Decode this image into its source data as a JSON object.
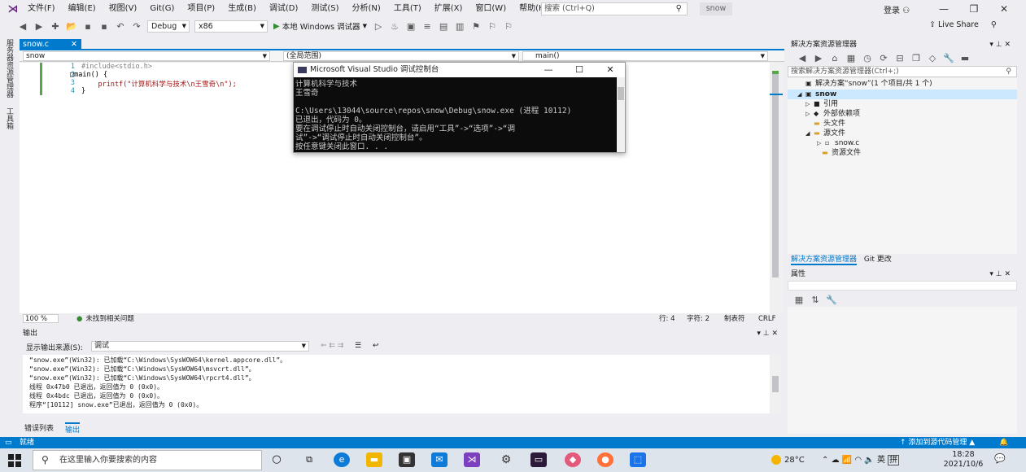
{
  "menubar": {
    "logo": "⋊",
    "items": [
      "文件(F)",
      "编辑(E)",
      "视图(V)",
      "Git(G)",
      "项目(P)",
      "生成(B)",
      "调试(D)",
      "测试(S)",
      "分析(N)",
      "工具(T)",
      "扩展(X)",
      "窗口(W)",
      "帮助(H)"
    ],
    "search_placeholder": "搜索 (Ctrl+Q)",
    "solution_name": "snow",
    "signin": "登录",
    "minimize": "—",
    "restore": "❐",
    "close": "✕"
  },
  "toolbar": {
    "config": "Debug",
    "platform": "x86",
    "run_label": "本地 Windows 调试器",
    "live_share": "Live Share"
  },
  "left_strip": {
    "tab1": "服务器资源管理器",
    "tab2": "工具箱"
  },
  "editor": {
    "tab_name": "snow.c",
    "tab_close": "✕",
    "nav_project": "snow",
    "nav_scope": "(全局范围)",
    "nav_member": "main()",
    "lines": [
      {
        "num": "1",
        "text": "#include<stdio.h>"
      },
      {
        "num": "2",
        "text": "□main() {"
      },
      {
        "num": "3",
        "text": "    printf(\"计算机科学与技术\\n王雪奇\\n\");"
      },
      {
        "num": "4",
        "text": "}"
      }
    ],
    "zoom": "100 %",
    "issues": "未找到相关问题",
    "row": "行: 4",
    "col": "字符: 2",
    "tabs_mode": "制表符",
    "eol": "CRLF"
  },
  "console": {
    "title": "Microsoft Visual Studio 调试控制台",
    "lines": [
      "计算机科学与技术",
      "王雪奇",
      "",
      "C:\\Users\\13044\\source\\repos\\snow\\Debug\\snow.exe (进程 10112)",
      "已退出，代码为 0。",
      "要在调试停止时自动关闭控制台，请启用“工具”->“选项”->“调",
      "试”->“调试停止时自动关闭控制台”。",
      "按任意键关闭此窗口. . ."
    ]
  },
  "output": {
    "title": "输出",
    "source_label": "显示输出来源(S):",
    "source_value": "调试",
    "lines": [
      "“snow.exe”(Win32): 已加载“C:\\Windows\\SysWOW64\\kernel.appcore.dll”。",
      "“snow.exe”(Win32): 已加载“C:\\Windows\\SysWOW64\\msvcrt.dll”。",
      "“snow.exe”(Win32): 已加载“C:\\Windows\\SysWOW64\\rpcrt4.dll”。",
      "线程 0x47b0 已退出，返回值为 0 (0x0)。",
      "线程 0x4bdc 已退出，返回值为 0 (0x0)。",
      "程序“[10112] snow.exe”已退出，返回值为 0 (0x0)。"
    ],
    "tab_errors": "错误列表",
    "tab_output": "输出"
  },
  "solution_explorer": {
    "title": "解决方案资源管理器",
    "search_placeholder": "搜索解决方案资源管理器(Ctrl+;)",
    "tree": [
      {
        "label": "解决方案“snow”(1 个项目/共 1 个)",
        "icon": "▣",
        "arrow": ""
      },
      {
        "label": "snow",
        "icon": "▣",
        "arrow": "◢"
      },
      {
        "label": "引用",
        "icon": "■",
        "arrow": "▷"
      },
      {
        "label": "外部依赖项",
        "icon": "◆",
        "arrow": "▷"
      },
      {
        "label": "头文件",
        "icon": "▬",
        "arrow": ""
      },
      {
        "label": "源文件",
        "icon": "▬",
        "arrow": "◢"
      },
      {
        "label": "snow.c",
        "icon": "▫",
        "arrow": "▷"
      },
      {
        "label": "资源文件",
        "icon": "▬",
        "arrow": ""
      }
    ],
    "tab_se": "解决方案资源管理器",
    "tab_git": "Git 更改"
  },
  "properties": {
    "title": "属性"
  },
  "status": {
    "ready": "就绪",
    "source_control": "↑ 添加到源代码管理 ▲"
  },
  "taskbar": {
    "search_placeholder": "在这里输入你要搜索的内容",
    "weather": "28°C",
    "ime": "英",
    "time": "18:28",
    "date": "2021/10/6"
  },
  "colors": {
    "accent": "#007acc",
    "console_bg": "#0c0c0c"
  }
}
